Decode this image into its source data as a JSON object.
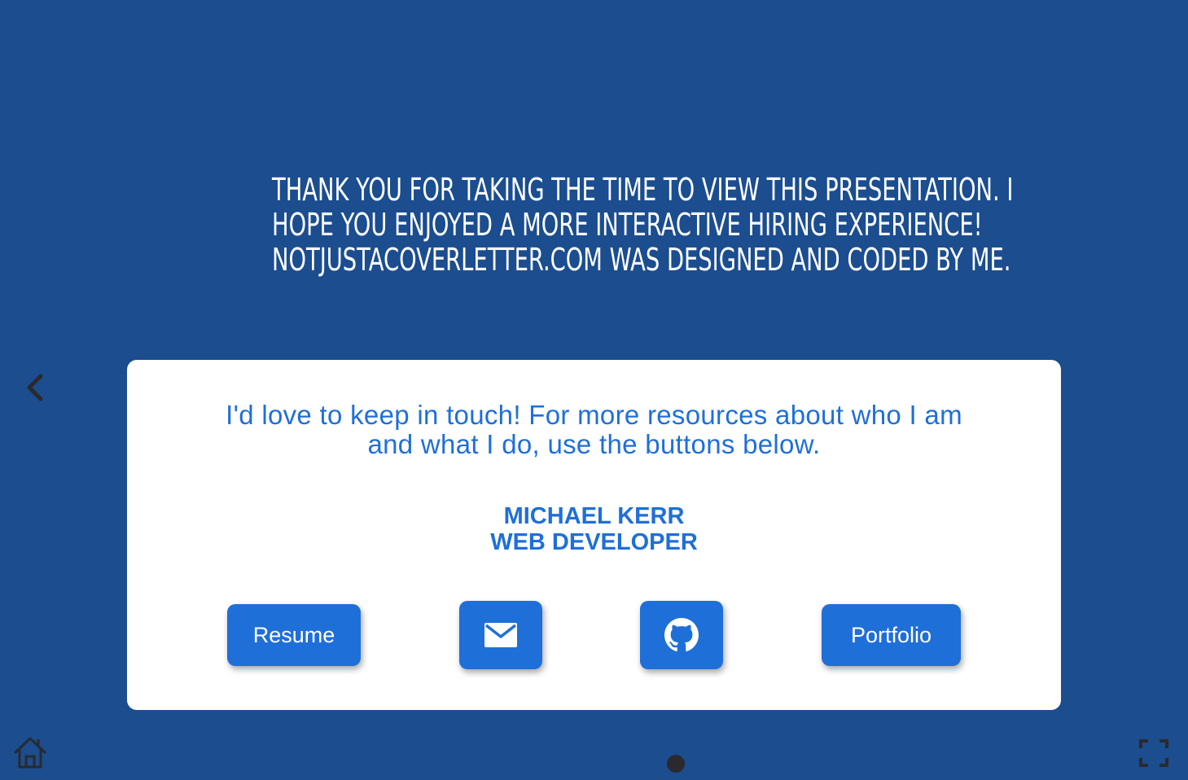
{
  "headline": {
    "line1": "THANK YOU FOR TAKING THE TIME TO VIEW THIS PRESENTATION. I",
    "line2": "HOPE YOU ENJOYED A MORE INTERACTIVE HIRING EXPERIENCE!",
    "line3": "NOTJUSTACOVERLETTER.COM WAS DESIGNED AND CODED BY ME."
  },
  "card": {
    "intro_line1": "I'd love to keep in touch! For more resources about who I am",
    "intro_line2": "and what I do, use the buttons below.",
    "name": "MICHAEL KERR",
    "role": "WEB DEVELOPER",
    "buttons": {
      "resume_label": "Resume",
      "email_icon": "envelope-icon",
      "github_icon": "github-icon",
      "portfolio_label": "Portfolio"
    }
  },
  "navigation": {
    "prev_icon": "chevron-left-icon",
    "home_icon": "home-icon",
    "fullscreen_icon": "fullscreen-icon",
    "slide_indicator_count": 1
  },
  "colors": {
    "background": "#1b4d8f",
    "accent": "#1f6fd8",
    "card": "#ffffff",
    "icons": "#2a2a2e"
  }
}
